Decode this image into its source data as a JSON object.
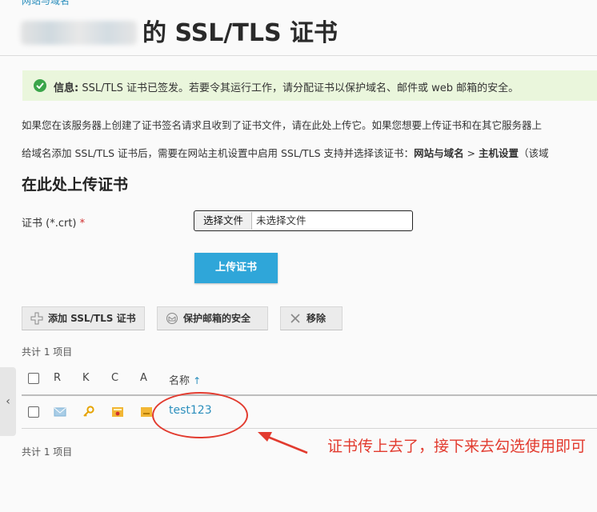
{
  "breadcrumb": "网站与域名",
  "title": "的 SSL/TLS 证书",
  "info": {
    "label": "信息:",
    "text": "SSL/TLS 证书已签发。若要令其运行工作，请分配证书以保护域名、邮件或 web 邮箱的安全。"
  },
  "description_1": "如果您在该服务器上创建了证书签名请求且收到了证书文件，请在此处上传它。如果您想要上传证书和在其它服务器上",
  "description_2": {
    "prefix": "给域名添加 SSL/TLS 证书后，需要在网站主机设置中启用 SSL/TLS 支持并选择该证书：",
    "path_1": "网站与域名",
    "sep": " > ",
    "path_2": "主机设置",
    "suffix": "（该域"
  },
  "upload_section": {
    "heading": "在此处上传证书",
    "field_label": "证书 (*.crt)",
    "required_mark": "*",
    "choose_button": "选择文件",
    "no_file": "未选择文件",
    "upload_button": "上传证书"
  },
  "toolbar": {
    "add": "添加 SSL/TLS 证书",
    "secure_mail": "保护邮箱的安全",
    "remove": "移除"
  },
  "count_top": "共计 1 项目",
  "count_bottom": "共计 1 项目",
  "table": {
    "columns": [
      "R",
      "K",
      "C",
      "A",
      "名称"
    ],
    "sort_indicator": "↑",
    "rows": [
      {
        "name": "test123",
        "icons": [
          "mail-icon",
          "key-icon",
          "certificate-icon",
          "ca-icon"
        ]
      }
    ]
  },
  "side_toggle": "‹",
  "annotation": "证书传上去了，接下来去勾选使用即可",
  "colors": {
    "accent": "#2fa6d9",
    "link": "#2c8fbd",
    "info_bg": "#eaf6dc",
    "success": "#3ba54a",
    "annotation": "#e23b2f"
  }
}
